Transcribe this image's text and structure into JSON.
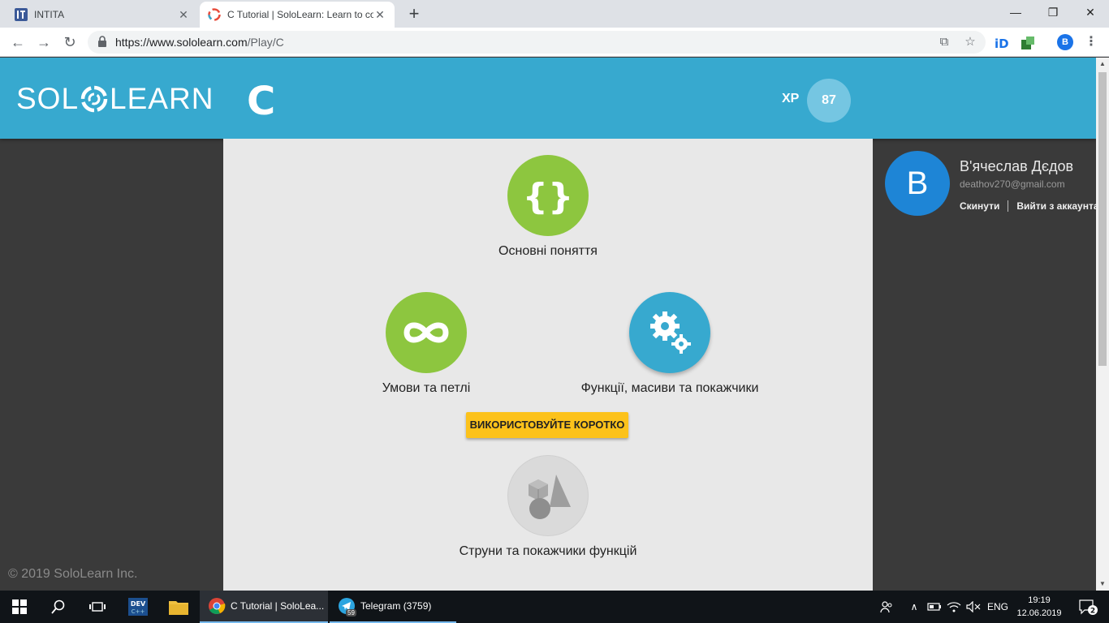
{
  "browser": {
    "tabs": [
      {
        "title": "INTITA",
        "active": false
      },
      {
        "title": "C Tutorial | SoloLearn: Learn to co",
        "active": true
      }
    ],
    "url_host": "https://www.sololearn.com",
    "url_path": "/Play/C",
    "profile_initial": "B"
  },
  "header": {
    "logo_left": "SOL",
    "logo_right": "LEARN",
    "course_letter": "C",
    "xp_label": "XP",
    "xp_value": "87"
  },
  "modules": [
    {
      "label": "Основні поняття",
      "icon": "braces-icon",
      "color": "#8dc63f"
    },
    {
      "label": "Умови та петлі",
      "icon": "infinity-icon",
      "color": "#8dc63f"
    },
    {
      "label": "Функції, масиви та покажчики",
      "icon": "gears-icon",
      "color": "#37a9cf"
    },
    {
      "label": "Струни та покажчики функцій",
      "icon": "shapes-icon",
      "color": "#dadada"
    }
  ],
  "shortcut_button": "ВИКОРИСТОВУЙТЕ КОРОТКО",
  "footer": {
    "copyright": "© 2019 SoloLearn Inc."
  },
  "profile": {
    "initial": "B",
    "name": "В'ячеслав Дєдов",
    "email": "deathov270@gmail.com",
    "reset_label": "Скинути",
    "logout_label": "Вийти з аккаунта"
  },
  "taskbar": {
    "apps": [
      {
        "label": "C Tutorial | SoloLea...",
        "active": true
      },
      {
        "label": "Telegram (3759)",
        "active": false
      }
    ],
    "telegram_badge": "59",
    "language": "ENG",
    "time": "19:19",
    "date": "12.06.2019",
    "notifications": "2"
  }
}
